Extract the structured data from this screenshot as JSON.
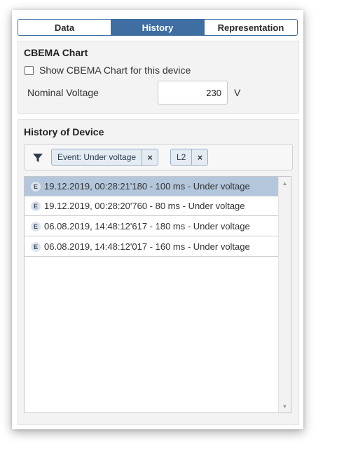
{
  "tabs": [
    {
      "label": "Data",
      "active": false
    },
    {
      "label": "History",
      "active": true
    },
    {
      "label": "Representation",
      "active": false
    }
  ],
  "cbema": {
    "title": "CBEMA Chart",
    "checkbox_label": "Show CBEMA Chart for this device",
    "checked": false,
    "nominal_voltage_label": "Nominal Voltage",
    "nominal_voltage_value": "230",
    "unit": "V"
  },
  "history": {
    "title": "History of Device",
    "filter_icon": "funnel-icon",
    "filters": [
      {
        "label": "Event: Under voltage",
        "remove": "×"
      },
      {
        "label": "L2",
        "remove": "×"
      }
    ],
    "rows": [
      {
        "badge": "E",
        "text": "19.12.2019, 00:28:21'180 - 100 ms - Under voltage",
        "selected": true
      },
      {
        "badge": "E",
        "text": "19.12.2019, 00:28:20'760 - 80 ms - Under voltage",
        "selected": false
      },
      {
        "badge": "E",
        "text": "06.08.2019, 14:48:12'617 - 180 ms - Under voltage",
        "selected": false
      },
      {
        "badge": "E",
        "text": "06.08.2019, 14:48:12'017 - 160 ms - Under voltage",
        "selected": false
      }
    ]
  },
  "colors": {
    "accent": "#3f6ea3",
    "selected_row": "#b3c6dc",
    "section_bg": "#f3f3f4"
  }
}
